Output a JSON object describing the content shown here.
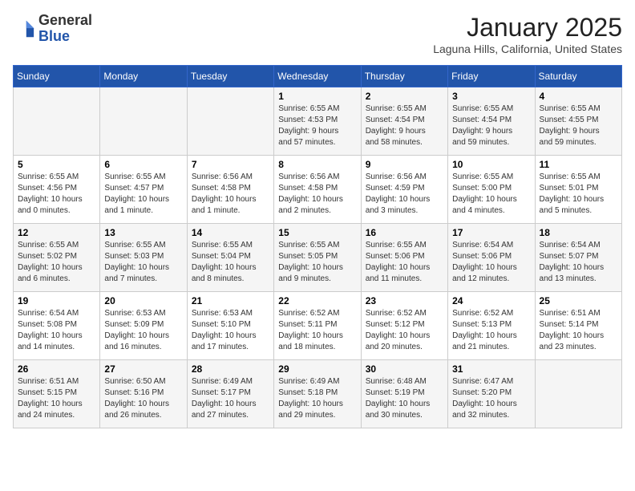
{
  "header": {
    "logo": {
      "line1": "General",
      "line2": "Blue"
    },
    "title": "January 2025",
    "subtitle": "Laguna Hills, California, United States"
  },
  "weekdays": [
    "Sunday",
    "Monday",
    "Tuesday",
    "Wednesday",
    "Thursday",
    "Friday",
    "Saturday"
  ],
  "weeks": [
    [
      {
        "num": "",
        "info": ""
      },
      {
        "num": "",
        "info": ""
      },
      {
        "num": "",
        "info": ""
      },
      {
        "num": "1",
        "info": "Sunrise: 6:55 AM\nSunset: 4:53 PM\nDaylight: 9 hours\nand 57 minutes."
      },
      {
        "num": "2",
        "info": "Sunrise: 6:55 AM\nSunset: 4:54 PM\nDaylight: 9 hours\nand 58 minutes."
      },
      {
        "num": "3",
        "info": "Sunrise: 6:55 AM\nSunset: 4:54 PM\nDaylight: 9 hours\nand 59 minutes."
      },
      {
        "num": "4",
        "info": "Sunrise: 6:55 AM\nSunset: 4:55 PM\nDaylight: 9 hours\nand 59 minutes."
      }
    ],
    [
      {
        "num": "5",
        "info": "Sunrise: 6:55 AM\nSunset: 4:56 PM\nDaylight: 10 hours\nand 0 minutes."
      },
      {
        "num": "6",
        "info": "Sunrise: 6:55 AM\nSunset: 4:57 PM\nDaylight: 10 hours\nand 1 minute."
      },
      {
        "num": "7",
        "info": "Sunrise: 6:56 AM\nSunset: 4:58 PM\nDaylight: 10 hours\nand 1 minute."
      },
      {
        "num": "8",
        "info": "Sunrise: 6:56 AM\nSunset: 4:58 PM\nDaylight: 10 hours\nand 2 minutes."
      },
      {
        "num": "9",
        "info": "Sunrise: 6:56 AM\nSunset: 4:59 PM\nDaylight: 10 hours\nand 3 minutes."
      },
      {
        "num": "10",
        "info": "Sunrise: 6:55 AM\nSunset: 5:00 PM\nDaylight: 10 hours\nand 4 minutes."
      },
      {
        "num": "11",
        "info": "Sunrise: 6:55 AM\nSunset: 5:01 PM\nDaylight: 10 hours\nand 5 minutes."
      }
    ],
    [
      {
        "num": "12",
        "info": "Sunrise: 6:55 AM\nSunset: 5:02 PM\nDaylight: 10 hours\nand 6 minutes."
      },
      {
        "num": "13",
        "info": "Sunrise: 6:55 AM\nSunset: 5:03 PM\nDaylight: 10 hours\nand 7 minutes."
      },
      {
        "num": "14",
        "info": "Sunrise: 6:55 AM\nSunset: 5:04 PM\nDaylight: 10 hours\nand 8 minutes."
      },
      {
        "num": "15",
        "info": "Sunrise: 6:55 AM\nSunset: 5:05 PM\nDaylight: 10 hours\nand 9 minutes."
      },
      {
        "num": "16",
        "info": "Sunrise: 6:55 AM\nSunset: 5:06 PM\nDaylight: 10 hours\nand 11 minutes."
      },
      {
        "num": "17",
        "info": "Sunrise: 6:54 AM\nSunset: 5:06 PM\nDaylight: 10 hours\nand 12 minutes."
      },
      {
        "num": "18",
        "info": "Sunrise: 6:54 AM\nSunset: 5:07 PM\nDaylight: 10 hours\nand 13 minutes."
      }
    ],
    [
      {
        "num": "19",
        "info": "Sunrise: 6:54 AM\nSunset: 5:08 PM\nDaylight: 10 hours\nand 14 minutes."
      },
      {
        "num": "20",
        "info": "Sunrise: 6:53 AM\nSunset: 5:09 PM\nDaylight: 10 hours\nand 16 minutes."
      },
      {
        "num": "21",
        "info": "Sunrise: 6:53 AM\nSunset: 5:10 PM\nDaylight: 10 hours\nand 17 minutes."
      },
      {
        "num": "22",
        "info": "Sunrise: 6:52 AM\nSunset: 5:11 PM\nDaylight: 10 hours\nand 18 minutes."
      },
      {
        "num": "23",
        "info": "Sunrise: 6:52 AM\nSunset: 5:12 PM\nDaylight: 10 hours\nand 20 minutes."
      },
      {
        "num": "24",
        "info": "Sunrise: 6:52 AM\nSunset: 5:13 PM\nDaylight: 10 hours\nand 21 minutes."
      },
      {
        "num": "25",
        "info": "Sunrise: 6:51 AM\nSunset: 5:14 PM\nDaylight: 10 hours\nand 23 minutes."
      }
    ],
    [
      {
        "num": "26",
        "info": "Sunrise: 6:51 AM\nSunset: 5:15 PM\nDaylight: 10 hours\nand 24 minutes."
      },
      {
        "num": "27",
        "info": "Sunrise: 6:50 AM\nSunset: 5:16 PM\nDaylight: 10 hours\nand 26 minutes."
      },
      {
        "num": "28",
        "info": "Sunrise: 6:49 AM\nSunset: 5:17 PM\nDaylight: 10 hours\nand 27 minutes."
      },
      {
        "num": "29",
        "info": "Sunrise: 6:49 AM\nSunset: 5:18 PM\nDaylight: 10 hours\nand 29 minutes."
      },
      {
        "num": "30",
        "info": "Sunrise: 6:48 AM\nSunset: 5:19 PM\nDaylight: 10 hours\nand 30 minutes."
      },
      {
        "num": "31",
        "info": "Sunrise: 6:47 AM\nSunset: 5:20 PM\nDaylight: 10 hours\nand 32 minutes."
      },
      {
        "num": "",
        "info": ""
      }
    ]
  ]
}
